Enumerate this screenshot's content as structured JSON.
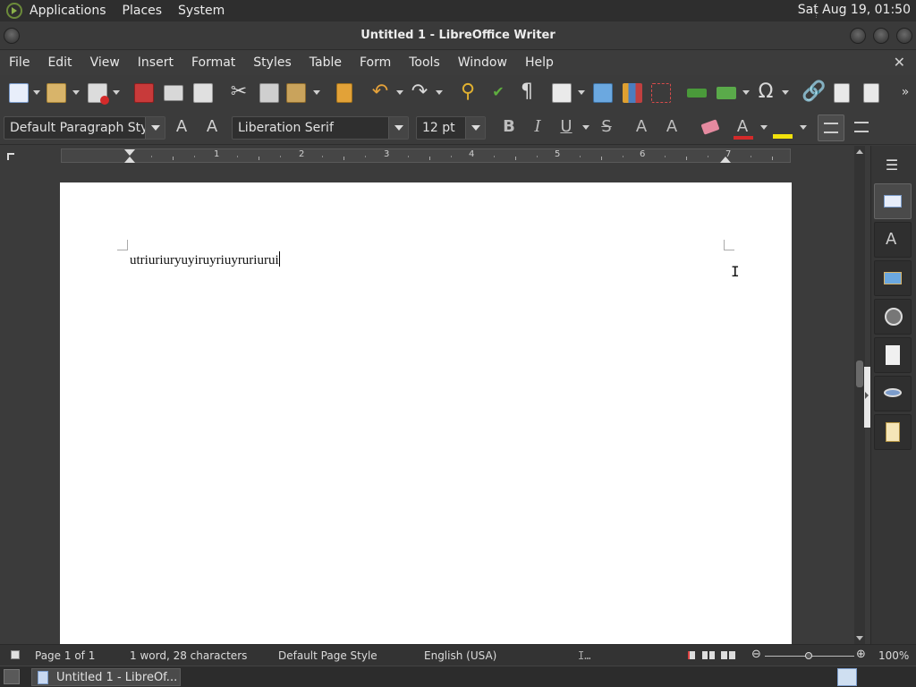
{
  "top_panel": {
    "menus": [
      "Applications",
      "Places",
      "System"
    ],
    "clock": "Sat Aug 19, 01:50"
  },
  "window": {
    "title": "Untitled 1 - LibreOffice Writer"
  },
  "menubar": {
    "items": [
      "File",
      "Edit",
      "View",
      "Insert",
      "Format",
      "Styles",
      "Table",
      "Form",
      "Tools",
      "Window",
      "Help"
    ]
  },
  "formatting": {
    "paragraph_style": "Default Paragraph Style",
    "font_name": "Liberation Serif",
    "font_size": "12 pt"
  },
  "ruler": {
    "labels": [
      "1",
      "2",
      "3",
      "4",
      "5",
      "6",
      "7"
    ]
  },
  "document": {
    "text": "utriuriuryuyiruyriuyruriurui"
  },
  "statusbar": {
    "page": "Page 1 of 1",
    "word_count": "1 word, 28 characters",
    "page_style": "Default Page Style",
    "language": "English (USA)",
    "zoom": "100%"
  },
  "taskbar": {
    "task_label": "Untitled 1 - LibreOf..."
  },
  "colors": {
    "font_color": "#d42a2a",
    "highlight_color": "#f2e20c",
    "accent": "#4a6fb0"
  }
}
